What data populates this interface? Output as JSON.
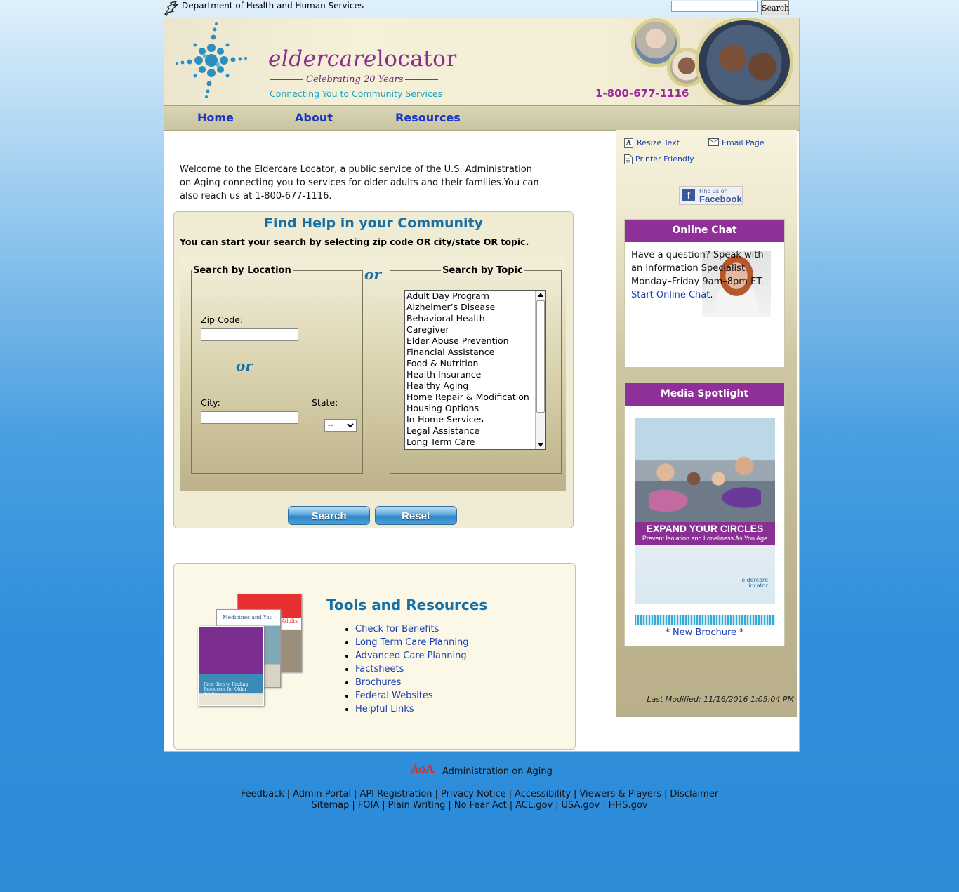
{
  "top": {
    "agency": "Department of Health and Human Services",
    "search_button": "Search"
  },
  "banner": {
    "brand_first": "eldercare",
    "brand_second": "locator",
    "celebrating": "Celebrating 20 Years",
    "tagline": "Connecting You to Community Services",
    "phone": "1-800-677-1116"
  },
  "nav": {
    "items": [
      {
        "label": "Home"
      },
      {
        "label": "About"
      },
      {
        "label": "Resources"
      }
    ]
  },
  "intro": {
    "text": "Welcome to the Eldercare Locator, a public service of the U.S. Administration on Aging connecting you to services for older adults and their families.You can also reach us at 1-800-677-1116."
  },
  "find_help": {
    "title": "Find Help in your Community",
    "subtitle": "You can start your search by selecting zip code OR city/state OR topic.",
    "location_legend": "Search by Location",
    "zip_label": "Zip Code:",
    "or_inner": "or",
    "or_between": "or",
    "city_label": "City:",
    "state_label": "State:",
    "state_selected": "--",
    "topic_legend": "Search by Topic",
    "topics": [
      "Adult Day Program",
      "Alzheimer’s Disease",
      "Behavioral Health",
      "Caregiver",
      "Elder Abuse Prevention",
      "Financial Assistance",
      "Food & Nutrition",
      "Health Insurance",
      "Healthy Aging",
      "Home Repair & Modification",
      "Housing Options",
      "In-Home Services",
      "Legal Assistance",
      "Long Term Care"
    ],
    "search_button": "Search",
    "reset_button": "Reset"
  },
  "tools": {
    "title": "Tools and Resources",
    "links": [
      "Check for Benefits",
      "Long Term Care Planning",
      "Advanced Care Planning",
      "Factsheets",
      "Brochures",
      "Federal Websites",
      "Helpful Links"
    ],
    "brochure_text_1": "Medicines and You",
    "brochure_text_2": "First Step to Finding Resources for Older Adults",
    "brochure_text_3": "Adults"
  },
  "sidebar": {
    "resize_text": "Resize Text",
    "email_page": "Email Page",
    "printer_friendly": "Printer Friendly",
    "facebook_small": "Find us on",
    "facebook_big": "Facebook",
    "chat_title": "Online Chat",
    "chat_text": "Have a question? Speak with an Information Specialist Monday–Friday 9am–8pm ET.",
    "chat_link": "Start Online Chat",
    "media_title": "Media Spotlight",
    "media_headline": "EXPAND YOUR CIRCLES",
    "media_subline": "Prevent Isolation and Loneliness As You Age",
    "media_brand": "eldercare locator",
    "media_link": "* New Brochure *",
    "last_modified": "Last Modified: 11/16/2016 1:05:04 PM"
  },
  "footer": {
    "aoa_logo": "AoA",
    "aoa_text": "Administration on Aging",
    "line1": [
      "Feedback",
      "Admin Portal",
      "API Registration",
      "Privacy Notice",
      "Accessibility",
      "Viewers & Players",
      "Disclaimer"
    ],
    "line2": [
      "Sitemap",
      "FOIA",
      "Plain Writing",
      "No Fear Act",
      "ACL.gov",
      "USA.gov",
      "HHS.gov"
    ]
  },
  "colors": {
    "brand_purple": "#8b2f8f",
    "heading_blue": "#1670a8",
    "link_blue": "#1a3fb0",
    "tan": "#bfb691"
  }
}
